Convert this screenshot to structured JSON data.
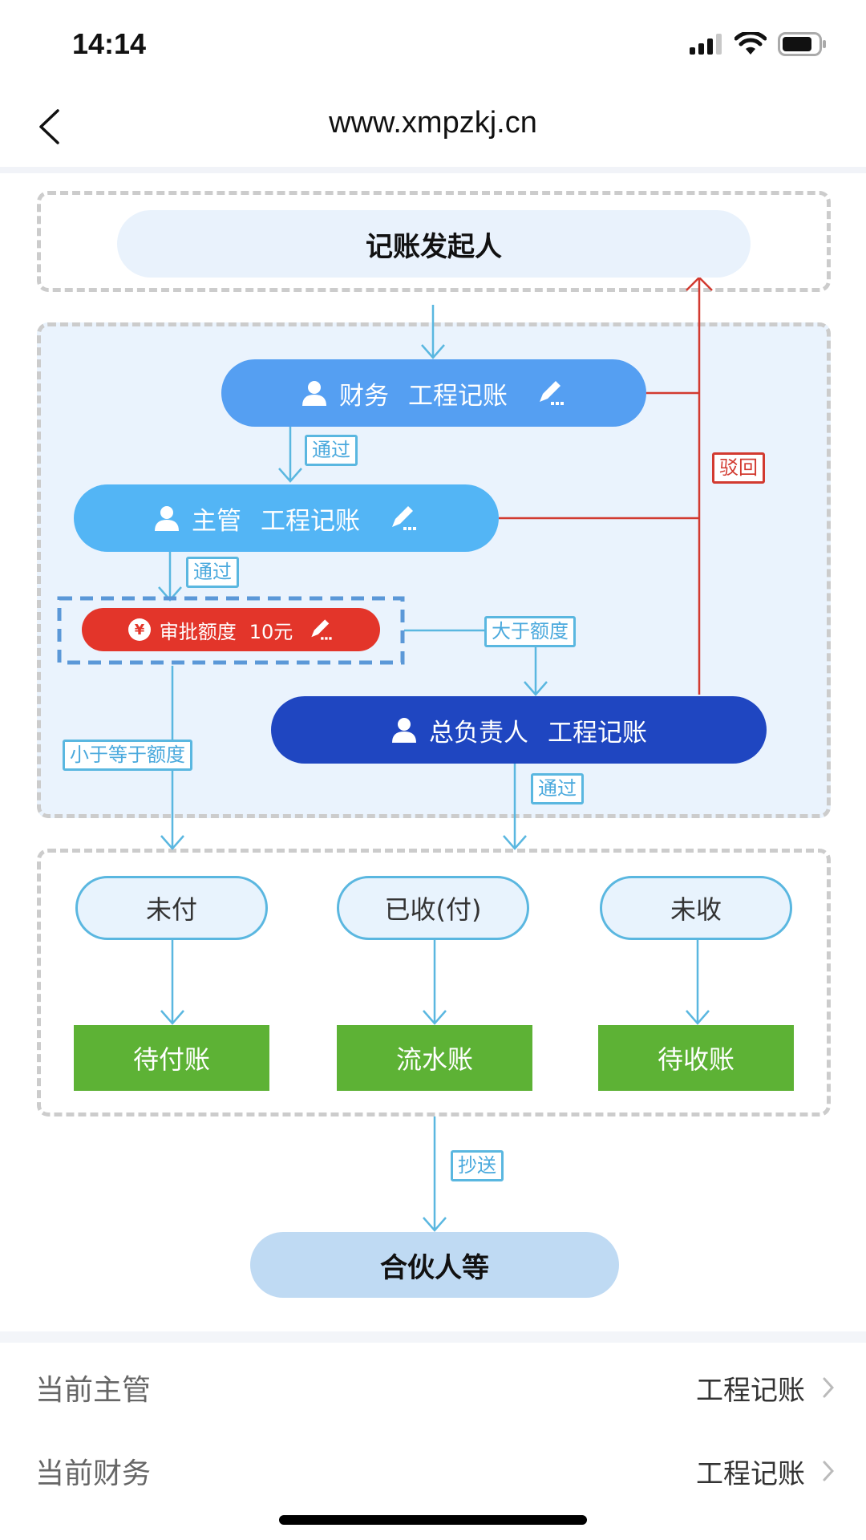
{
  "status_bar": {
    "time": "14:14",
    "icons": [
      "signal-icon",
      "wifi-icon",
      "battery-icon"
    ]
  },
  "nav": {
    "back_icon": "chevron-left-icon",
    "title": "www.xmpzkj.cn"
  },
  "flow": {
    "initiator": "记账发起人",
    "finance_node": {
      "role": "财务",
      "name": "工程记账",
      "icon": "user-icon",
      "edit_icon": "edit-icon"
    },
    "supervisor_node": {
      "role": "主管",
      "name": "工程记账",
      "icon": "user-icon",
      "edit_icon": "edit-icon"
    },
    "approval_limit": {
      "label": "审批额度",
      "amount": "10元",
      "icon": "yen-icon",
      "edit_icon": "edit-icon"
    },
    "director_node": {
      "role": "总负责人",
      "name": "工程记账",
      "icon": "user-icon"
    },
    "edge_labels": {
      "pass_1": "通过",
      "pass_2": "通过",
      "pass_3": "通过",
      "above_limit": "大于额度",
      "below_or_equal_limit": "小于等于额度",
      "reject": "驳回",
      "cc": "抄送"
    },
    "statuses": [
      "未付",
      "已收(付)",
      "未收"
    ],
    "ledgers": [
      "待付账",
      "流水账",
      "待收账"
    ],
    "cc_target": "合伙人等",
    "colors": {
      "finance": "#559ff2",
      "supervisor": "#53b5f5",
      "approval": "#e3352a",
      "director": "#1f46c1",
      "ledger": "#5db235",
      "connector": "#5ab7e0",
      "reject_line": "#d23a30"
    }
  },
  "settings": [
    {
      "label": "当前主管",
      "value": "工程记账"
    },
    {
      "label": "当前财务",
      "value": "工程记账"
    }
  ]
}
